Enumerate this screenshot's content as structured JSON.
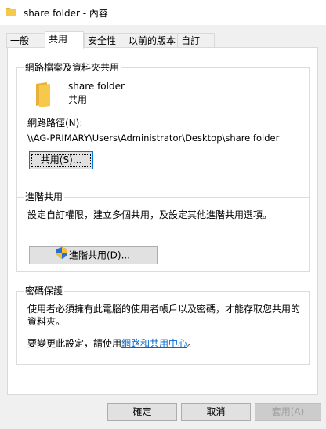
{
  "window": {
    "title": "share folder - 內容"
  },
  "tabs": [
    {
      "label": "一般"
    },
    {
      "label": "共用"
    },
    {
      "label": "安全性"
    },
    {
      "label": "以前的版本"
    },
    {
      "label": "自訂"
    }
  ],
  "network_sharing": {
    "group_label": "網路檔案及資料夾共用",
    "folder_name": "share folder",
    "share_status": "共用",
    "path_label": "網路路徑(N):",
    "path_value": "\\\\AG-PRIMARY\\Users\\Administrator\\Desktop\\share folder",
    "share_button": "共用(S)..."
  },
  "advanced_sharing": {
    "group_label": "進階共用",
    "description": "設定自訂權限，建立多個共用，及設定其他進階共用選項。",
    "button": "進階共用(D)..."
  },
  "password_protection": {
    "group_label": "密碼保護",
    "description_line1": "使用者必須擁有此電腦的使用者帳戶以及密碼，才能存取您共用的",
    "description_line2": "資料夾。",
    "change_prefix": "要變更此設定，請使用",
    "link_text": "網路和共用中心",
    "change_suffix": "。"
  },
  "footer": {
    "ok": "確定",
    "cancel": "取消",
    "apply": "套用(A)"
  },
  "colors": {
    "folder": "#f6c94c",
    "link": "#0066cc",
    "focus": "#0078d7"
  },
  "icons": [
    "folder-icon",
    "shield-icon"
  ]
}
